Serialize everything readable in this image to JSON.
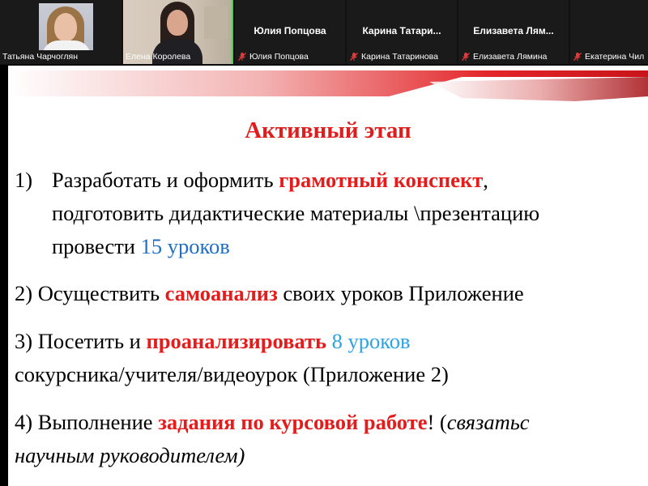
{
  "participants": [
    {
      "name": "Татьяна Чарчоглян",
      "muted": false,
      "video": true,
      "active": false
    },
    {
      "name": "Елена Королева",
      "muted": false,
      "video": true,
      "active": true
    },
    {
      "name": "Юлия Попцова",
      "display_name": "Юлия Попцова",
      "muted": true,
      "video": false,
      "active": false
    },
    {
      "name": "Карина Татаринова",
      "display_name": "Карина Татари...",
      "muted": true,
      "video": false,
      "active": false
    },
    {
      "name": "Елизавета Лямина",
      "display_name": "Елизавета Лям...",
      "muted": true,
      "video": false,
      "active": false
    },
    {
      "name": "Екатерина Чил",
      "muted": true,
      "video": false,
      "active": false
    }
  ],
  "slide": {
    "title": "Активный этап",
    "item1": {
      "number": "1)",
      "line1_a": "Разработать и оформить ",
      "line1_b": "грамотный конспект",
      "line1_c": ",",
      "line2": "подготовить дидактические материалы \\презентацию",
      "line3_a": "провести ",
      "line3_b": "15 уроков"
    },
    "item2": {
      "a": "2) Осуществить ",
      "b": "самоанализ",
      "c": " своих уроков  Приложение"
    },
    "item3": {
      "a": "3) Посетить и ",
      "b": "проанализировать",
      "c": " ",
      "d": "8 уроков",
      "line2": "сокурсника/учителя/видеоурок  (Приложение 2)"
    },
    "item4": {
      "a": "4) Выполнение ",
      "b": "задания по курсовой работе",
      "c": "! (",
      "d": "связатьс",
      "line2": "научным руководителем)"
    }
  },
  "colors": {
    "accent_red": "#e61b1b",
    "link_blue": "#1f6fc7",
    "light_blue": "#2ba3e6",
    "active_speaker": "#4fd14f",
    "muted_icon": "#e03a3a"
  }
}
